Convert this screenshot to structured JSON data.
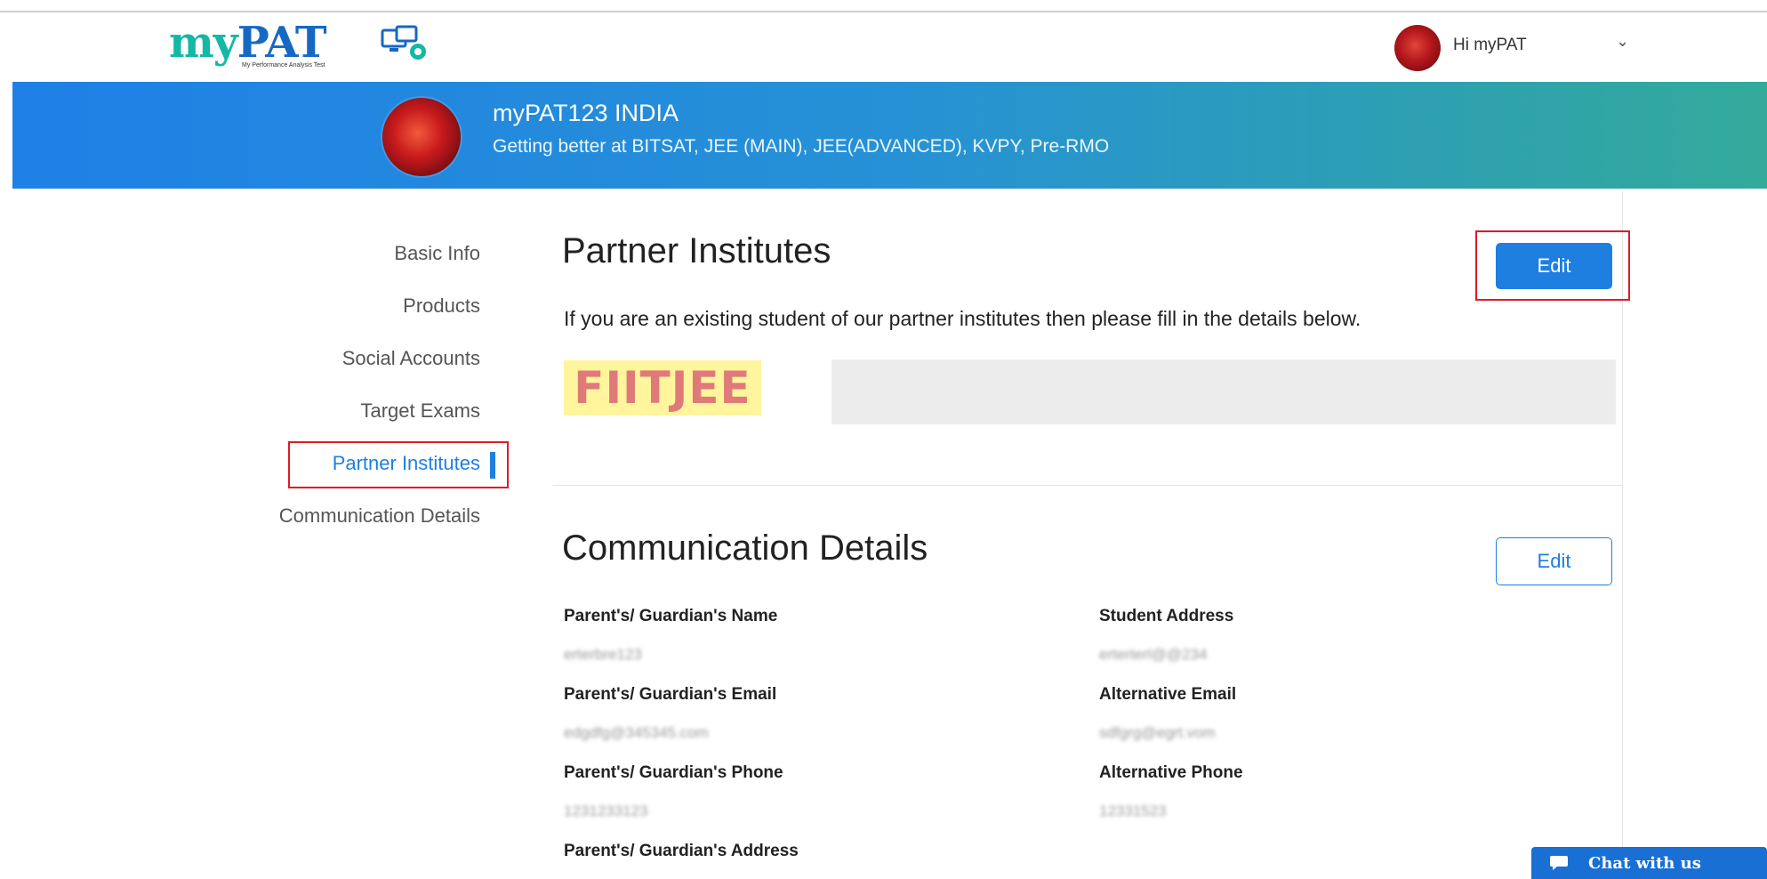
{
  "header": {
    "logo": {
      "my": "my",
      "pat": "PAT",
      "tagline": "My Performance Analysis Test"
    },
    "user": {
      "greeting": "Hi myPAT",
      "caret": "⌄"
    }
  },
  "banner": {
    "name": "myPAT123 INDIA",
    "subtitle": "Getting better at BITSAT, JEE (MAIN), JEE(ADVANCED), KVPY, Pre-RMO"
  },
  "sidebar": {
    "items": [
      {
        "label": "Basic Info",
        "active": false
      },
      {
        "label": "Products",
        "active": false
      },
      {
        "label": "Social Accounts",
        "active": false
      },
      {
        "label": "Target Exams",
        "active": false
      },
      {
        "label": "Partner Institutes",
        "active": true
      },
      {
        "label": "Communication Details",
        "active": false
      }
    ]
  },
  "partner_institutes": {
    "title": "Partner Institutes",
    "edit_label": "Edit",
    "description": "If you are an existing student of our partner institutes then please fill in the details below.",
    "institute_logo_text": "FIITJEE",
    "institute_value": ""
  },
  "communication_details": {
    "title": "Communication Details",
    "edit_label": "Edit",
    "fields": {
      "parent_name": {
        "label": "Parent's/ Guardian's Name",
        "value": "erterbre123"
      },
      "student_address": {
        "label": "Student Address",
        "value": "erterterl@@234"
      },
      "parent_email": {
        "label": "Parent's/ Guardian's Email",
        "value": "edgdfg@345345.com"
      },
      "alt_email": {
        "label": "Alternative Email",
        "value": "sdfgrg@egrt.vom"
      },
      "parent_phone": {
        "label": "Parent's/ Guardian's Phone",
        "value": "1231233123"
      },
      "alt_phone": {
        "label": "Alternative Phone",
        "value": "12331523"
      },
      "parent_address": {
        "label": "Parent's/ Guardian's Address"
      }
    }
  },
  "chat": {
    "label": "Chat with us"
  },
  "colors": {
    "accent": "#1e7fe0",
    "highlight": "#e01b24",
    "chat": "#1a6fd4"
  }
}
